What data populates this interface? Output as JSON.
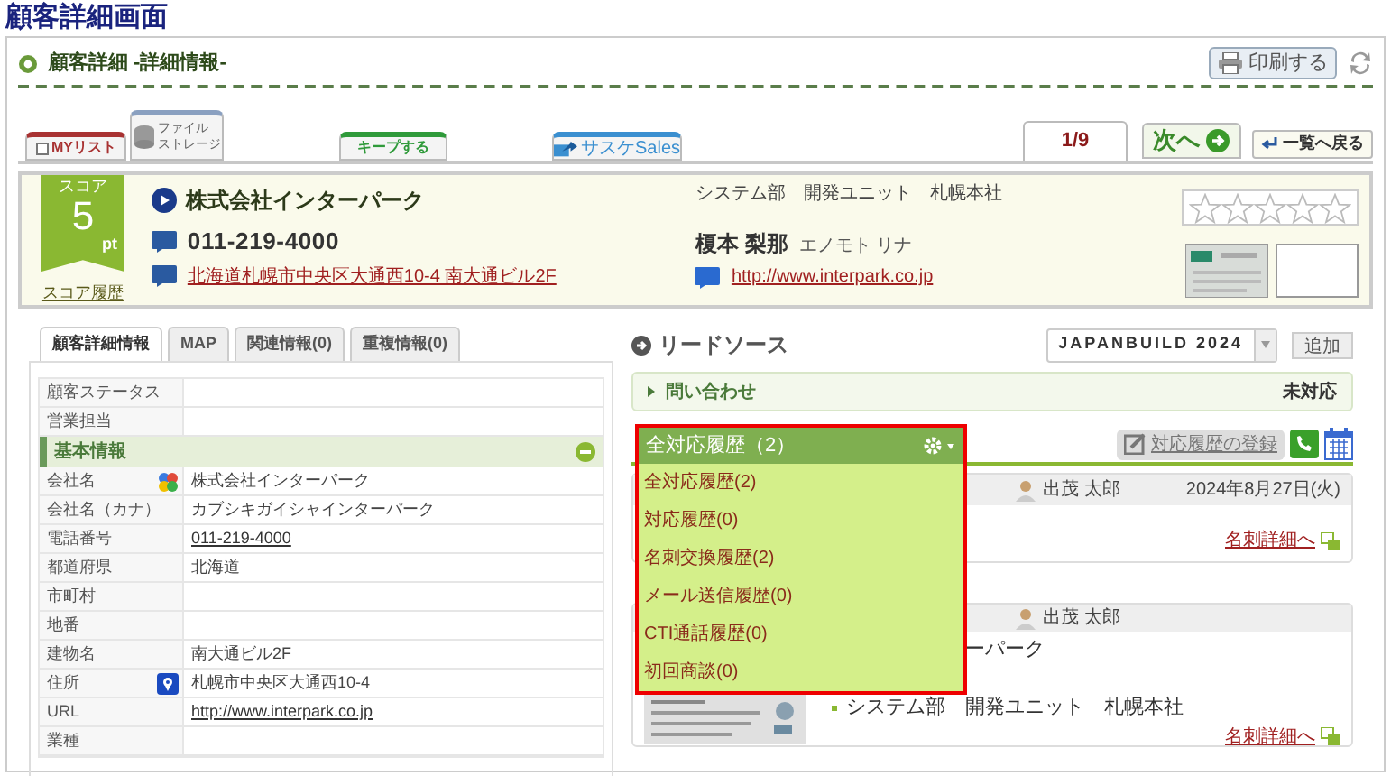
{
  "page_title": "顧客詳細画面",
  "header": {
    "title": "顧客詳細 -詳細情報-",
    "print_button": "印刷する"
  },
  "top_tabs": [
    {
      "kind": "checkbox",
      "label": "MYリスト",
      "checked": false,
      "color": "#a83232"
    },
    {
      "kind": "storage",
      "label_lines": [
        "ファイル",
        "ストレージ"
      ],
      "color": "#8aa0c0"
    },
    {
      "kind": "plain",
      "label": "キープする",
      "color": "#2f9a3a"
    },
    {
      "kind": "sales",
      "label": "サスケSales",
      "color": "#3a8fd0"
    }
  ],
  "pager": {
    "position": "1/9",
    "next": "次へ",
    "back": "一覧へ戻る"
  },
  "summary": {
    "score_label": "スコア",
    "score": "5",
    "score_unit": "pt",
    "score_history": "スコア履歴",
    "company": "株式会社インターパーク",
    "phone": "011-219-4000",
    "address": "北海道札幌市中央区大通西10-4 南大通ビル2F",
    "department": "システム部　開発ユニット　札幌本社",
    "person_name": "榎本 梨那",
    "person_kana": "エノモト リナ",
    "url": "http://www.interpark.co.jp",
    "stars": 0
  },
  "detail_tabs": [
    {
      "label": "顧客詳細情報",
      "selected": true
    },
    {
      "label": "MAP",
      "selected": false
    },
    {
      "label": "関連情報(0)",
      "selected": false
    },
    {
      "label": "重複情報(0)",
      "selected": false
    }
  ],
  "detail_rows": [
    {
      "kind": "field",
      "label": "顧客ステータス"
    },
    {
      "kind": "field",
      "label": "営業担当"
    },
    {
      "kind": "section",
      "label": "基本情報",
      "expanded": true
    },
    {
      "kind": "logo",
      "label": "会社名",
      "value": "株式会社インターパーク"
    },
    {
      "kind": "field",
      "label": "会社名（カナ）",
      "value": "カブシキガイシャインターパーク"
    },
    {
      "kind": "link",
      "label": "電話番号",
      "value": "011-219-4000"
    },
    {
      "kind": "field",
      "label": "都道府県",
      "value": "北海道"
    },
    {
      "kind": "field",
      "label": "市町村"
    },
    {
      "kind": "field",
      "label": "地番"
    },
    {
      "kind": "field",
      "label": "建物名",
      "value": "南大通ビル2F"
    },
    {
      "kind": "pin",
      "label": "住所",
      "value": "札幌市中央区大通西10-4"
    },
    {
      "kind": "link",
      "label": "URL",
      "value": "http://www.interpark.co.jp"
    },
    {
      "kind": "field",
      "label": "業種"
    }
  ],
  "lead_source": {
    "title": "リードソース",
    "selected_event": "JAPANBUILD 2024",
    "add_button": "追加",
    "inquiry": "問い合わせ",
    "inquiry_status": "未対応"
  },
  "history": {
    "menu_title": "全対応履歴（2）",
    "menu_items": [
      "全対応履歴(2)",
      "対応履歴(0)",
      "名刺交換履歴(2)",
      "メール送信履歴(0)",
      "CTI通話履歴(0)",
      "初回商談(0)"
    ],
    "register_button": "対応履歴の登録",
    "cards": [
      {
        "user": "出茂 太郎",
        "date": "2024年8月27日(火)",
        "link": "名刺詳細へ"
      },
      {
        "user": "出茂 太郎",
        "fragment": "ーパーク",
        "department": "システム部　開発ユニット　札幌本社",
        "link": "名刺詳細へ"
      }
    ]
  }
}
